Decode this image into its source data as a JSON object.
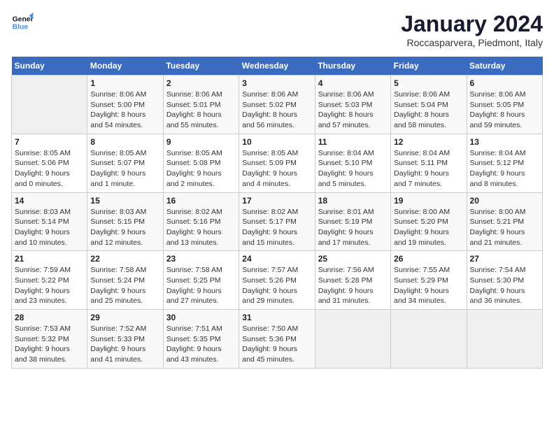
{
  "header": {
    "logo_line1": "General",
    "logo_line2": "Blue",
    "title": "January 2024",
    "subtitle": "Roccasparvera, Piedmont, Italy"
  },
  "columns": [
    "Sunday",
    "Monday",
    "Tuesday",
    "Wednesday",
    "Thursday",
    "Friday",
    "Saturday"
  ],
  "weeks": [
    [
      {
        "day": "",
        "info": ""
      },
      {
        "day": "1",
        "info": "Sunrise: 8:06 AM\nSunset: 5:00 PM\nDaylight: 8 hours\nand 54 minutes."
      },
      {
        "day": "2",
        "info": "Sunrise: 8:06 AM\nSunset: 5:01 PM\nDaylight: 8 hours\nand 55 minutes."
      },
      {
        "day": "3",
        "info": "Sunrise: 8:06 AM\nSunset: 5:02 PM\nDaylight: 8 hours\nand 56 minutes."
      },
      {
        "day": "4",
        "info": "Sunrise: 8:06 AM\nSunset: 5:03 PM\nDaylight: 8 hours\nand 57 minutes."
      },
      {
        "day": "5",
        "info": "Sunrise: 8:06 AM\nSunset: 5:04 PM\nDaylight: 8 hours\nand 58 minutes."
      },
      {
        "day": "6",
        "info": "Sunrise: 8:06 AM\nSunset: 5:05 PM\nDaylight: 8 hours\nand 59 minutes."
      }
    ],
    [
      {
        "day": "7",
        "info": "Sunrise: 8:05 AM\nSunset: 5:06 PM\nDaylight: 9 hours\nand 0 minutes."
      },
      {
        "day": "8",
        "info": "Sunrise: 8:05 AM\nSunset: 5:07 PM\nDaylight: 9 hours\nand 1 minute."
      },
      {
        "day": "9",
        "info": "Sunrise: 8:05 AM\nSunset: 5:08 PM\nDaylight: 9 hours\nand 2 minutes."
      },
      {
        "day": "10",
        "info": "Sunrise: 8:05 AM\nSunset: 5:09 PM\nDaylight: 9 hours\nand 4 minutes."
      },
      {
        "day": "11",
        "info": "Sunrise: 8:04 AM\nSunset: 5:10 PM\nDaylight: 9 hours\nand 5 minutes."
      },
      {
        "day": "12",
        "info": "Sunrise: 8:04 AM\nSunset: 5:11 PM\nDaylight: 9 hours\nand 7 minutes."
      },
      {
        "day": "13",
        "info": "Sunrise: 8:04 AM\nSunset: 5:12 PM\nDaylight: 9 hours\nand 8 minutes."
      }
    ],
    [
      {
        "day": "14",
        "info": "Sunrise: 8:03 AM\nSunset: 5:14 PM\nDaylight: 9 hours\nand 10 minutes."
      },
      {
        "day": "15",
        "info": "Sunrise: 8:03 AM\nSunset: 5:15 PM\nDaylight: 9 hours\nand 12 minutes."
      },
      {
        "day": "16",
        "info": "Sunrise: 8:02 AM\nSunset: 5:16 PM\nDaylight: 9 hours\nand 13 minutes."
      },
      {
        "day": "17",
        "info": "Sunrise: 8:02 AM\nSunset: 5:17 PM\nDaylight: 9 hours\nand 15 minutes."
      },
      {
        "day": "18",
        "info": "Sunrise: 8:01 AM\nSunset: 5:19 PM\nDaylight: 9 hours\nand 17 minutes."
      },
      {
        "day": "19",
        "info": "Sunrise: 8:00 AM\nSunset: 5:20 PM\nDaylight: 9 hours\nand 19 minutes."
      },
      {
        "day": "20",
        "info": "Sunrise: 8:00 AM\nSunset: 5:21 PM\nDaylight: 9 hours\nand 21 minutes."
      }
    ],
    [
      {
        "day": "21",
        "info": "Sunrise: 7:59 AM\nSunset: 5:22 PM\nDaylight: 9 hours\nand 23 minutes."
      },
      {
        "day": "22",
        "info": "Sunrise: 7:58 AM\nSunset: 5:24 PM\nDaylight: 9 hours\nand 25 minutes."
      },
      {
        "day": "23",
        "info": "Sunrise: 7:58 AM\nSunset: 5:25 PM\nDaylight: 9 hours\nand 27 minutes."
      },
      {
        "day": "24",
        "info": "Sunrise: 7:57 AM\nSunset: 5:26 PM\nDaylight: 9 hours\nand 29 minutes."
      },
      {
        "day": "25",
        "info": "Sunrise: 7:56 AM\nSunset: 5:28 PM\nDaylight: 9 hours\nand 31 minutes."
      },
      {
        "day": "26",
        "info": "Sunrise: 7:55 AM\nSunset: 5:29 PM\nDaylight: 9 hours\nand 34 minutes."
      },
      {
        "day": "27",
        "info": "Sunrise: 7:54 AM\nSunset: 5:30 PM\nDaylight: 9 hours\nand 36 minutes."
      }
    ],
    [
      {
        "day": "28",
        "info": "Sunrise: 7:53 AM\nSunset: 5:32 PM\nDaylight: 9 hours\nand 38 minutes."
      },
      {
        "day": "29",
        "info": "Sunrise: 7:52 AM\nSunset: 5:33 PM\nDaylight: 9 hours\nand 41 minutes."
      },
      {
        "day": "30",
        "info": "Sunrise: 7:51 AM\nSunset: 5:35 PM\nDaylight: 9 hours\nand 43 minutes."
      },
      {
        "day": "31",
        "info": "Sunrise: 7:50 AM\nSunset: 5:36 PM\nDaylight: 9 hours\nand 45 minutes."
      },
      {
        "day": "",
        "info": ""
      },
      {
        "day": "",
        "info": ""
      },
      {
        "day": "",
        "info": ""
      }
    ]
  ]
}
